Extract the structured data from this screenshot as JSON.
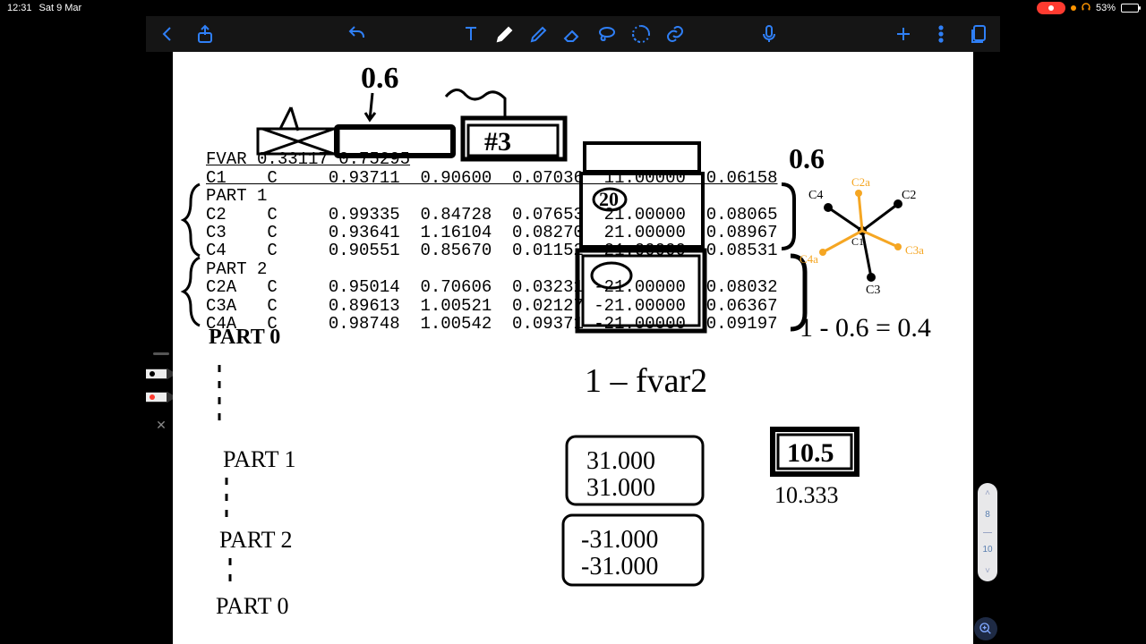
{
  "status": {
    "time": "12:31",
    "date": "Sat 9 Mar",
    "battery_pct": "53%",
    "battery_fill_pct": 53
  },
  "toolbar": {
    "back": "Back",
    "share": "Share",
    "undo": "Undo",
    "text_tool": "Text",
    "pen_tool": "Pen",
    "highlighter_tool": "Highlighter",
    "eraser_tool": "Eraser",
    "lasso_tool": "Lasso",
    "shape_tool": "Shape",
    "link_tool": "Link",
    "mic": "Microphone",
    "add": "Add",
    "more": "More",
    "pages": "Pages"
  },
  "palette": {
    "pen1_color": "#000000",
    "pen2_color": "#ff3b30"
  },
  "page_rail": {
    "current": "8",
    "total": "10"
  },
  "table": {
    "fvar": "FVAR 0.33117 0.75295",
    "c1": "C1    C     0.93711  0.90600  0.07036  11.00000  0.06158",
    "part1": "PART 1",
    "c2": "C2    C     0.99335  0.84728  0.07653  21.00000  0.08065",
    "c3": "C3    C     0.93641  1.16104  0.08270  21.00000  0.08967",
    "c4": "C4    C     0.90551  0.85670  0.01152  21.00000  0.08531",
    "part2": "PART 2",
    "c2a": "C2A   C     0.95014  0.70606  0.03231 -21.00000  0.08032",
    "c3a": "C3A   C     0.89613  1.00521  0.02127 -21.00000  0.06367",
    "c4a": "C4A   C     0.98748  1.00542  0.09371 -21.00000  0.09197"
  },
  "hand": {
    "top_06": "0.6",
    "third": "#3",
    "right_06": "0.6",
    "atoms": {
      "c1": "C1",
      "c2": "C2",
      "c3": "C3",
      "c4": "C4",
      "c2a": "C2a",
      "c3a": "C3a",
      "c4a": "C4a"
    },
    "calc": "1 - 0.6 = 0.4",
    "fvar_expr": "1 – fvar2",
    "part0a": "PART 0",
    "part1b": "PART 1",
    "part2b": "PART 2",
    "part0c": "PART 0",
    "thirty1a": "31.000",
    "thirty1b": "31.000",
    "neg31a": "-31.000",
    "neg31b": "-31.000",
    "ten5": "10.5",
    "ten333": "10.333",
    "scribble_20": "20"
  }
}
